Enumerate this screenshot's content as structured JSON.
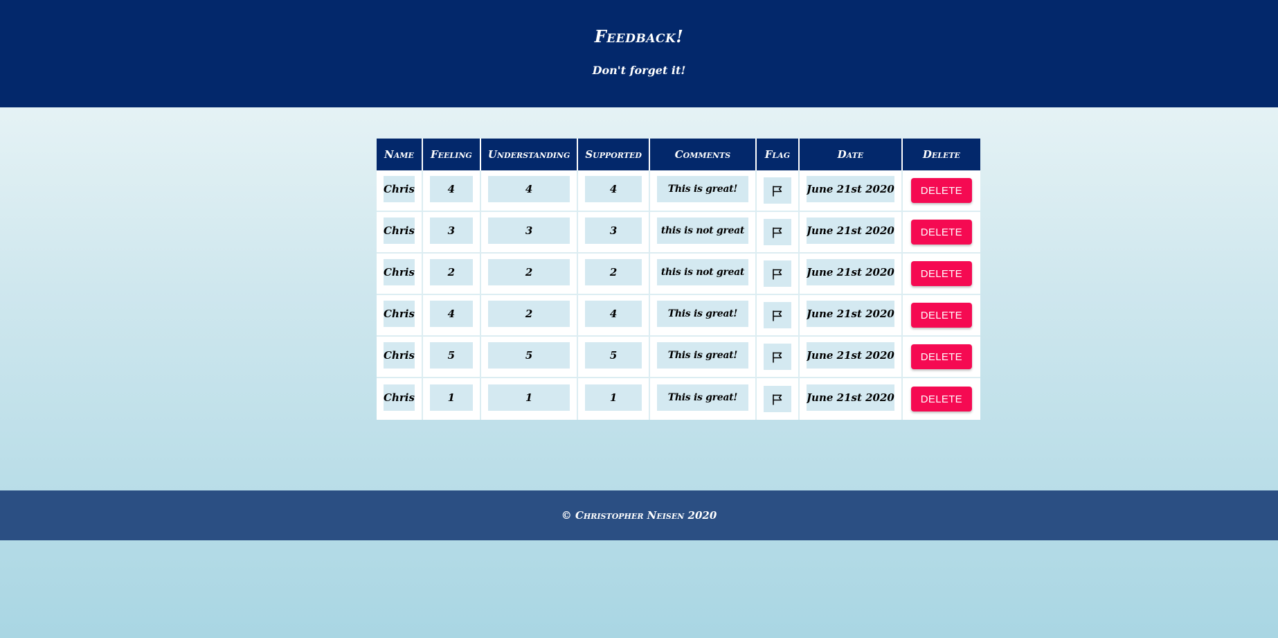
{
  "header": {
    "title": "Feedback!",
    "subtitle": "Don't forget it!"
  },
  "table": {
    "columns": [
      "Name",
      "Feeling",
      "Understanding",
      "Supported",
      "Comments",
      "Flag",
      "Date",
      "Delete"
    ],
    "rows": [
      {
        "name": "Chris",
        "feeling": "4",
        "understanding": "4",
        "supported": "4",
        "comments": "This is great!",
        "date": "June 21st 2020",
        "delete_label": "DELETE"
      },
      {
        "name": "Chris",
        "feeling": "3",
        "understanding": "3",
        "supported": "3",
        "comments": "this is not great",
        "date": "June 21st 2020",
        "delete_label": "DELETE"
      },
      {
        "name": "Chris",
        "feeling": "2",
        "understanding": "2",
        "supported": "2",
        "comments": "this is not great",
        "date": "June 21st 2020",
        "delete_label": "DELETE"
      },
      {
        "name": "Chris",
        "feeling": "4",
        "understanding": "2",
        "supported": "4",
        "comments": "This is great!",
        "date": "June 21st 2020",
        "delete_label": "DELETE"
      },
      {
        "name": "Chris",
        "feeling": "5",
        "understanding": "5",
        "supported": "5",
        "comments": "This is great!",
        "date": "June 21st 2020",
        "delete_label": "DELETE"
      },
      {
        "name": "Chris",
        "feeling": "1",
        "understanding": "1",
        "supported": "1",
        "comments": "This is great!",
        "date": "June 21st 2020",
        "delete_label": "DELETE"
      }
    ],
    "flag_icon": "flag-outline-icon"
  },
  "footer": {
    "text": "© Christopher Neisen 2020"
  },
  "colors": {
    "header_bg": "#03286b",
    "footer_bg": "#2b4f83",
    "cell_bg": "#d4e9f1",
    "delete_button": "#f50a52"
  }
}
